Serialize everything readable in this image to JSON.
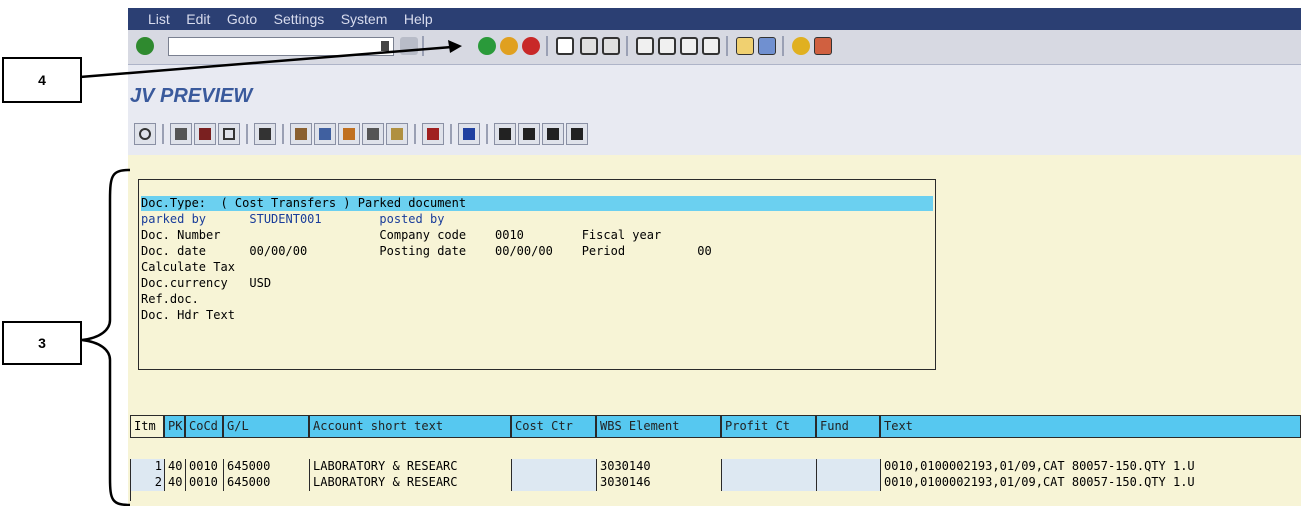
{
  "menu": [
    "List",
    "Edit",
    "Goto",
    "Settings",
    "System",
    "Help"
  ],
  "toolbar1": {
    "icons": [
      "enter-icon",
      "back-icon",
      "exit-icon",
      "cancel-icon",
      "print-icon",
      "find-icon",
      "find-next-icon",
      "first-page-icon",
      "previous-page-icon",
      "next-page-icon",
      "last-page-icon",
      "create-session-icon",
      "shortcut-icon",
      "help-icon",
      "layout-icon"
    ]
  },
  "title": "JV PREVIEW",
  "toolbar2": {
    "icons": [
      "detail-icon",
      "print-icon",
      "filter-icon",
      "set-filter-icon",
      "sum-icon",
      "export-icon",
      "sort-icon",
      "spreadsheet-icon",
      "word-icon",
      "mail-icon",
      "layout-grid-icon",
      "info-icon",
      "first-icon",
      "previous-icon",
      "next-icon",
      "last-icon"
    ]
  },
  "header": {
    "line1": "Doc.Type:  ( Cost Transfers ) Parked document",
    "line2": "parked by      STUDENT001        posted by",
    "line3": "Doc. Number                      Company code    0010        Fiscal year",
    "line4": "Doc. date      00/00/00          Posting date    00/00/00    Period          00",
    "line5": "Calculate Tax",
    "line6": "Doc.currency   USD",
    "line7": "Ref.doc.",
    "line8": "Doc. Hdr Text"
  },
  "grid": {
    "columns": [
      "Itm",
      "PK",
      "CoCd",
      "G/L",
      "Account short text",
      "Cost Ctr",
      "WBS Element",
      "Profit Ct",
      "Fund",
      "Text"
    ],
    "rows": [
      [
        "1",
        "40",
        "0010",
        "645000",
        "LABORATORY & RESEARC",
        "",
        "3030140",
        "",
        "",
        "0010,0100002193,01/09,CAT 80057-150.QTY 1.U"
      ],
      [
        "2",
        "40",
        "0010",
        "645000",
        "LABORATORY & RESEARC",
        "",
        "3030146",
        "",
        "",
        "0010,0100002193,01/09,CAT 80057-150.QTY 1.U"
      ]
    ]
  },
  "callouts": {
    "c4": "4",
    "c3": "3"
  }
}
